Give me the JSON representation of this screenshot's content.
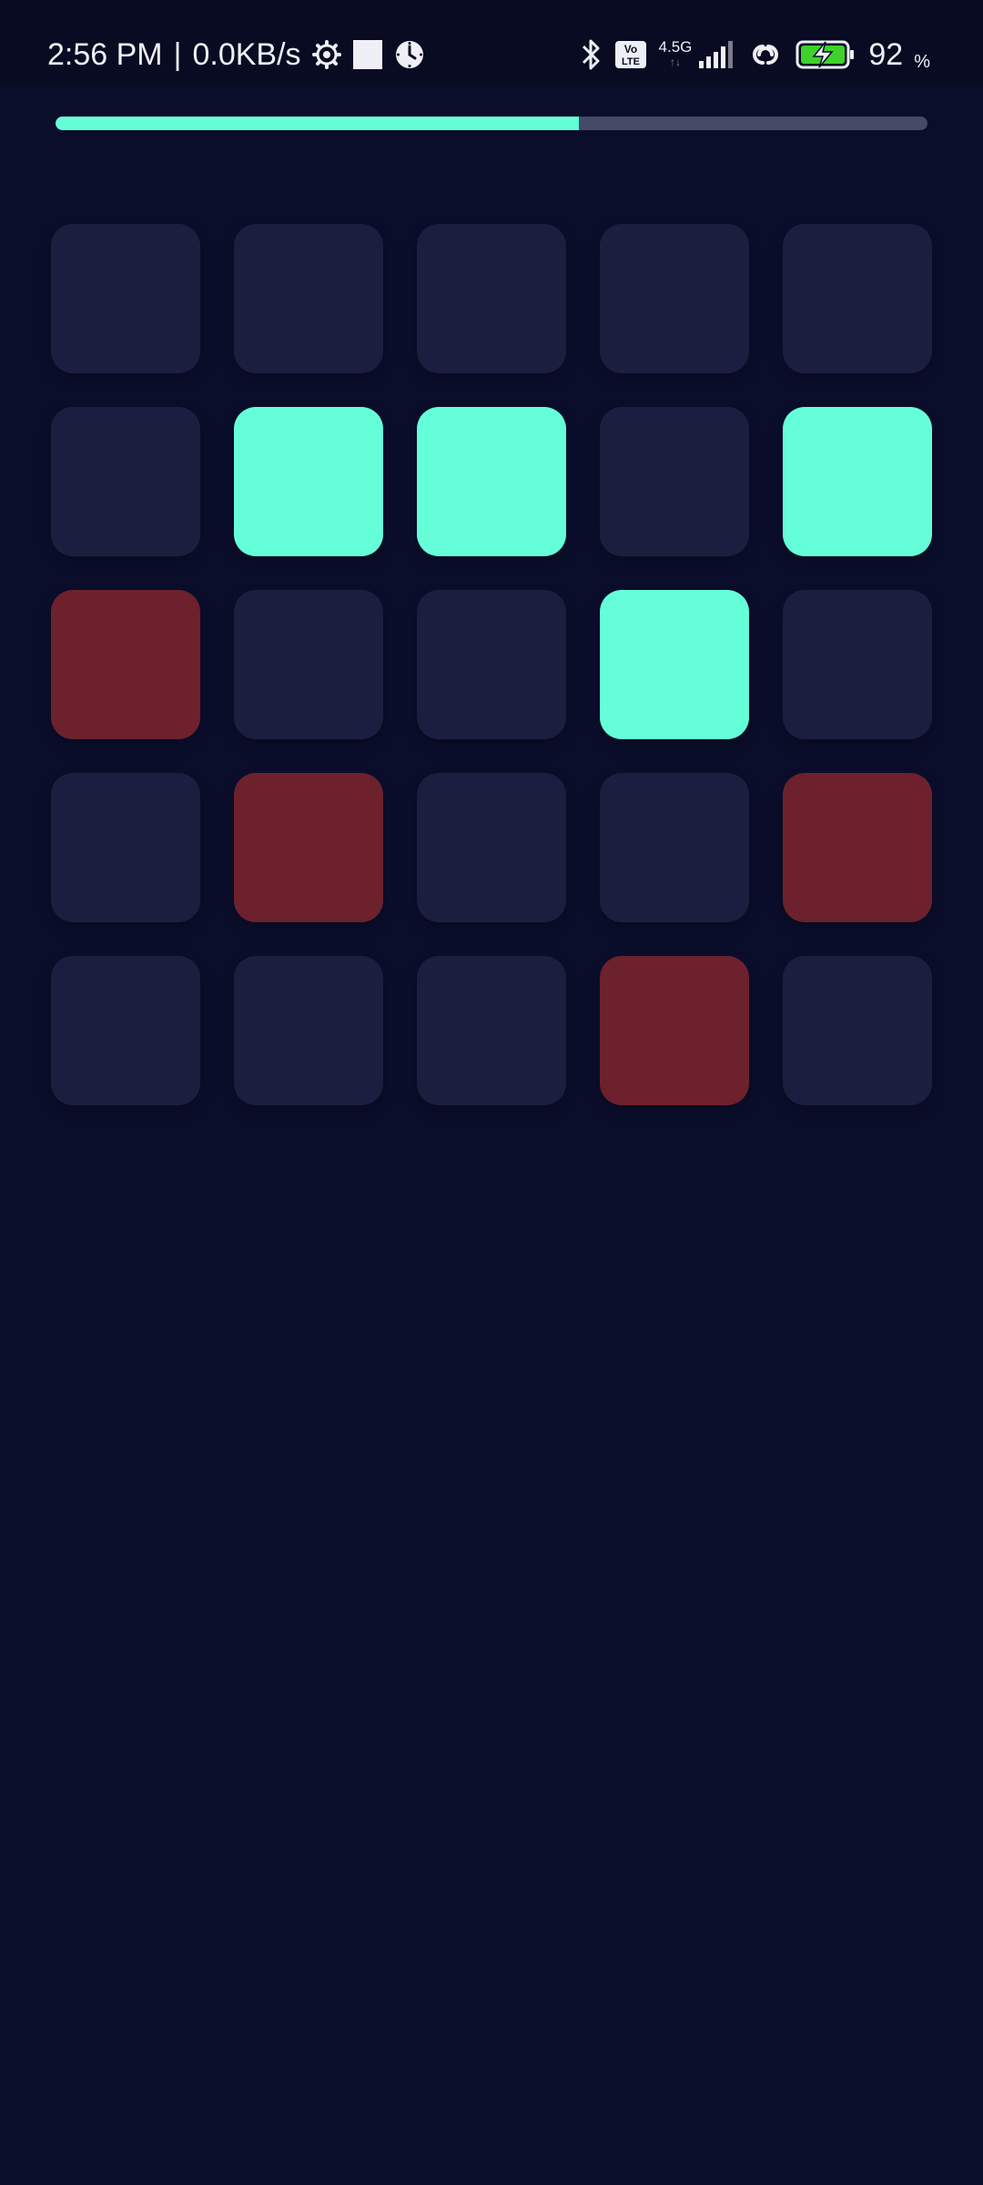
{
  "status_bar": {
    "time": "2:56 PM",
    "separator": "|",
    "net_speed": "0.0KB/s",
    "volte_label_top": "Vo",
    "volte_label_bottom": "LTE",
    "network_type": "4.5G",
    "battery_percent": "92",
    "battery_percent_sign": "%",
    "icons": {
      "left": [
        "settings-gear-icon",
        "white-square-icon",
        "alarm-clock-icon"
      ],
      "right": [
        "bluetooth-icon",
        "volte-icon",
        "signal-bars-icon",
        "link-icon",
        "battery-charging-icon"
      ]
    }
  },
  "progress": {
    "value": 0.6,
    "fill_color": "#64ffd9",
    "track_color": "#454a66"
  },
  "board": {
    "rows": 5,
    "columns": 5,
    "colors": {
      "empty": "#1b1e3e",
      "lit": "#64ffd9",
      "miss": "#6c212d",
      "background": "#0b0e2b"
    },
    "tiles": [
      [
        "empty",
        "empty",
        "empty",
        "empty",
        "empty"
      ],
      [
        "empty",
        "lit",
        "lit",
        "empty",
        "lit"
      ],
      [
        "miss",
        "empty",
        "empty",
        "lit",
        "empty"
      ],
      [
        "empty",
        "miss",
        "empty",
        "empty",
        "miss"
      ],
      [
        "empty",
        "empty",
        "empty",
        "miss",
        "empty"
      ]
    ]
  }
}
